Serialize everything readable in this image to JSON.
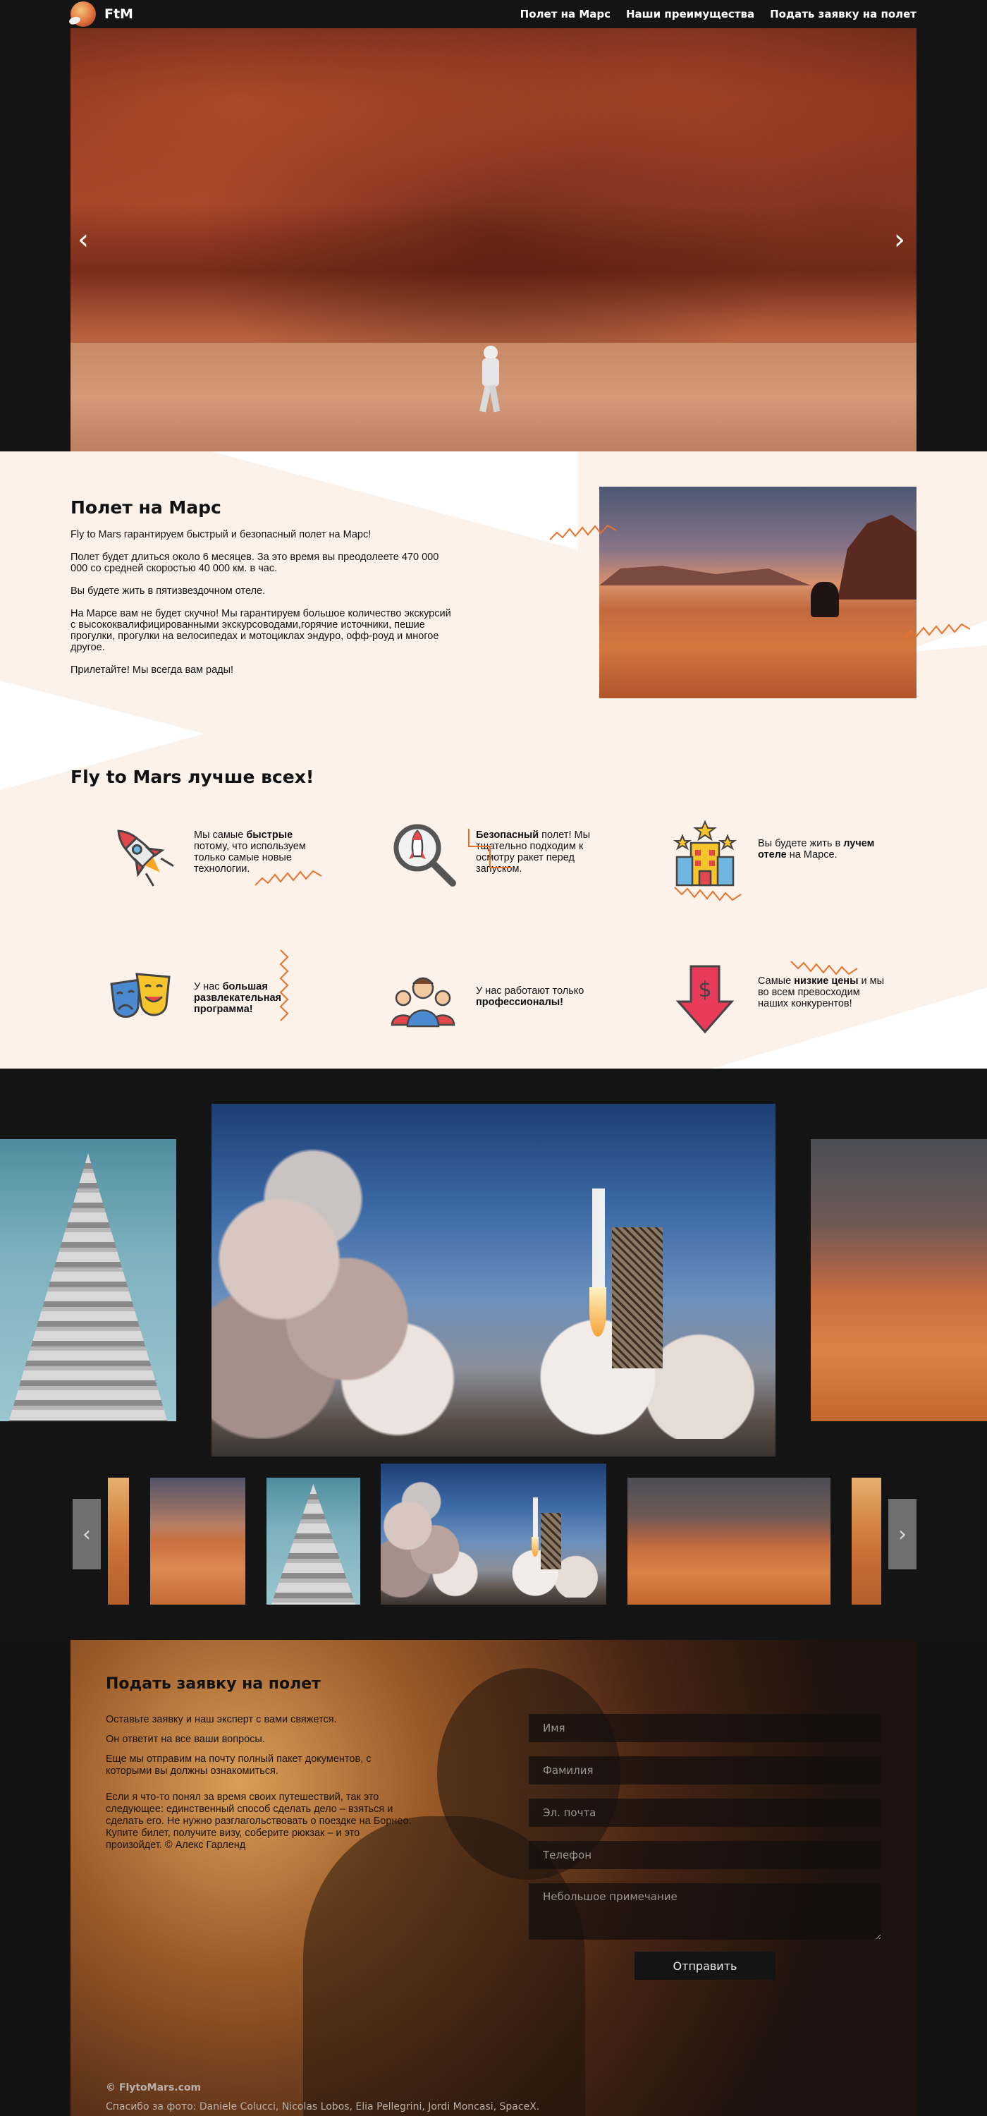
{
  "nav": {
    "logo_text": "FtM",
    "links": [
      "Полет на Марс",
      "Наши преимущества",
      "Подать заявку на полет"
    ]
  },
  "hero": {
    "prev_arrow": "‹",
    "next_arrow": "›"
  },
  "about": {
    "title": "Полет на Марс",
    "paragraphs": [
      "Fly to Mars гарантируем быстрый и безопасный полет на Марс!",
      "Полет будет длиться около 6 месяцев. За это время вы преодолеете 470 000 000 со средней скоростью 40 000 км. в час.",
      "Вы будете жить в пятизвездочном отеле.",
      "На Марсе вам не будет скучно! Мы гарантируем большое количество экскурсий с высококвалифицированными экскурсоводами,горячие источники, пешие прогулки, прогулки на велосипедах и мотоциклах эндуро, офф-роуд и многое другое.",
      "Прилетайте! Мы всегда вам рады!"
    ]
  },
  "features": {
    "title": "Fly to Mars лучше всех!",
    "items": [
      {
        "pre": "Мы самые ",
        "bold": "быстрые",
        "post": " потому, что используем только самые новые технологии.",
        "icon": "rocket-icon"
      },
      {
        "pre": "",
        "bold": "Безопасный",
        "post": " полет! Мы тщательно подходим к осмотру ракет перед запуском.",
        "icon": "magnifier-rocket-icon"
      },
      {
        "pre": "Вы будете жить в ",
        "bold": "лучем отеле",
        "post": " на Марсе.",
        "icon": "hotel-icon"
      },
      {
        "pre": "У нас ",
        "bold": "большая развлекательная программа!",
        "post": "",
        "icon": "theater-masks-icon"
      },
      {
        "pre": "У нас работают только ",
        "bold": "профессионалы!",
        "post": "",
        "icon": "team-icon"
      },
      {
        "pre": "Самые ",
        "bold": "низкие цены",
        "post": " и мы во всем превосходим наших конкурентов!",
        "icon": "price-down-icon"
      }
    ]
  },
  "gallery": {
    "prev_arrow": "‹",
    "next_arrow": "›"
  },
  "form": {
    "title": "Подать заявку на полет",
    "paragraphs": [
      "Оставьте заявку и наш эксперт с вами свяжется.",
      "Он ответит на все ваши вопросы.",
      "Еще мы отправим на почту полный пакет документов, с которыми вы должны ознакомиться."
    ],
    "quote": "Если я что-то понял за время своих путешествий, так это следующее: единственный способ сделать дело – взяться и сделать его. Не нужно разглагольствовать о поездке на Борнео. Купите билет, получите визу, соберите рюкзак – и это произойдет. © Алекс Гарленд",
    "fields": {
      "name": "Имя",
      "surname": "Фамилия",
      "email": "Эл. почта",
      "phone": "Телефон",
      "note": "Небольшое примечание"
    },
    "submit": "Отправить",
    "copyright": "© FlytoMars.com",
    "credits": "Спасибо за фото: Daniele Colucci, Nicolas Lobos, Elia Pellegrini, Jordi Moncasi, SpaceX."
  }
}
